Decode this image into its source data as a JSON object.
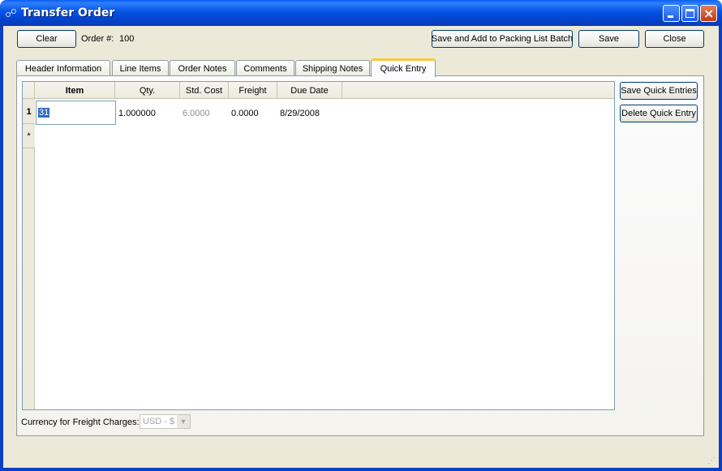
{
  "window": {
    "title": "Transfer Order"
  },
  "toolbar": {
    "clear_label": "Clear",
    "order_label": "Order #:",
    "order_number": "100",
    "save_add_batch_label": "Save and Add to Packing List Batch",
    "save_label": "Save",
    "close_label": "Close"
  },
  "tabs": [
    {
      "label": "Header Information"
    },
    {
      "label": "Line Items"
    },
    {
      "label": "Order Notes"
    },
    {
      "label": "Comments"
    },
    {
      "label": "Shipping Notes"
    },
    {
      "label": "Quick Entry",
      "active": true
    }
  ],
  "grid": {
    "columns": [
      "Item",
      "Qty.",
      "Std. Cost",
      "Freight",
      "Due Date"
    ],
    "rows": [
      {
        "row_header": "1",
        "item": "31",
        "qty": "1.000000",
        "std_cost": "6.0000",
        "freight": "0.0000",
        "due_date": "8/29/2008"
      }
    ],
    "new_row_marker": "*"
  },
  "side_buttons": {
    "save_quick_entries": "Save Quick Entries",
    "delete_quick_entry": "Delete Quick Entry"
  },
  "currency": {
    "label": "Currency for Freight Charges:",
    "value": "USD - $"
  },
  "colors": {
    "titlebar": "#0552e3",
    "window_bg": "#ece9d8",
    "active_tab_accent": "#ffc83c",
    "selection": "#316ac5"
  }
}
